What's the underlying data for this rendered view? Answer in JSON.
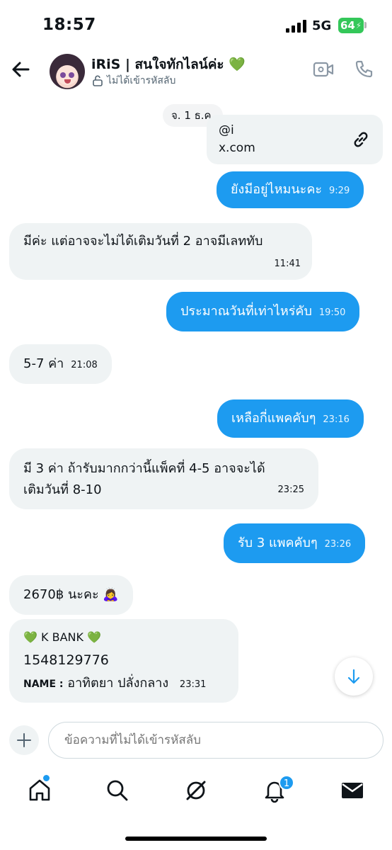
{
  "status_bar": {
    "time": "18:57",
    "network": "5G",
    "battery": "64"
  },
  "header": {
    "back_icon": "arrow-left-icon",
    "name": "iRiS | สนใจทักไลน์ค่ะ",
    "name_emoji": "💚",
    "encryption_status": "ไม่ได้เข้ารหัสลับ",
    "video_icon": "video-camera-icon",
    "call_icon": "phone-icon"
  },
  "conversation": {
    "date_separator": "จ. 1 ธ.ค.",
    "link_card": {
      "handle": "@i",
      "domain": "x.com",
      "icon": "link-icon"
    },
    "messages": [
      {
        "text": "ยังมีอยู่ไหมนะคะ",
        "time": "9:29"
      },
      {
        "text": "มีค่ะ แต่อาจจะไม่ได้เติมวันที่ 2 อาจมีเลททับ",
        "time": "11:41"
      },
      {
        "text": "ประมาณวันที่เท่าไหร่คับ",
        "time": "19:50"
      },
      {
        "text": "5-7 ค่า",
        "time": "21:08"
      },
      {
        "text": "เหลือกี่แพคคับๆ",
        "time": "23:16"
      },
      {
        "line1": "มี 3 ค่า ถ้ารับมากกว่านี้แพ็คที่ 4-5 อาจจะได้",
        "line2": "เติมวันที่ 8-10",
        "time": "23:25"
      },
      {
        "text": "รับ 3 แพคคับๆ",
        "time": "23:26"
      },
      {
        "text": "2670฿ นะคะ",
        "emoji": "🙇‍♀️"
      },
      {
        "bank": "K BANK",
        "heart": "💚",
        "account": "1548129776",
        "name_label": "NAME :",
        "name_value": "อาทิตยา ปลั่งกลาง",
        "time": "23:31"
      }
    ]
  },
  "scroll_down_icon": "arrow-down-icon",
  "composer": {
    "add_icon": "plus-icon",
    "placeholder": "ข้อความที่ไม่ได้เข้ารหัสลับ"
  },
  "bottom_nav": {
    "items": [
      "home-icon",
      "search-icon",
      "grok-icon",
      "bell-icon",
      "mail-icon"
    ],
    "notification_count": "1"
  },
  "colors": {
    "accent": "#1d9bf0",
    "incoming": "#eff3f4",
    "battery": "#34c759"
  }
}
